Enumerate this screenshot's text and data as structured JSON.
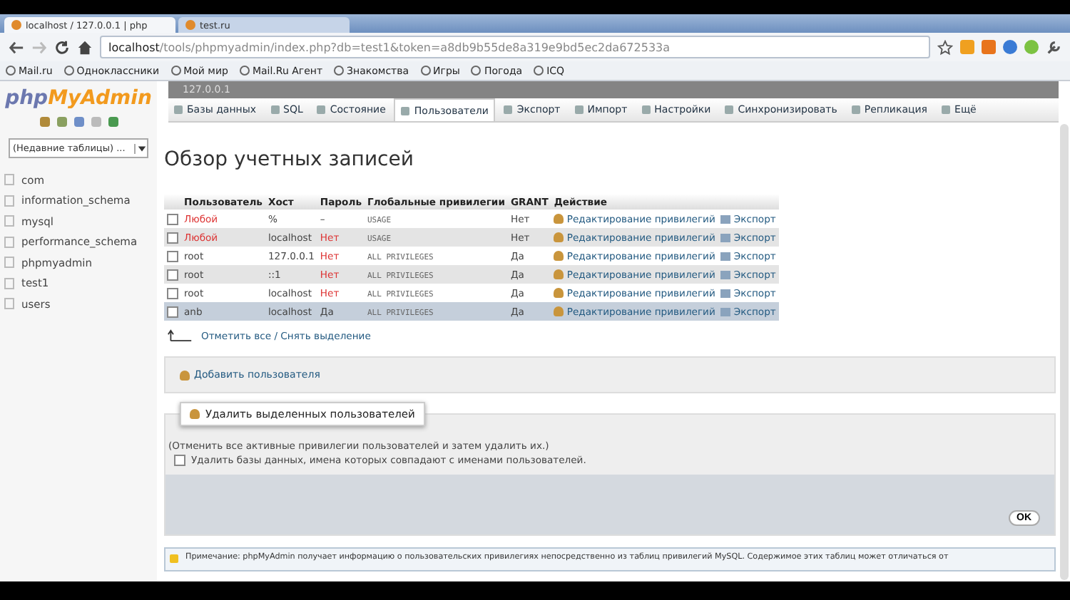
{
  "browser": {
    "tabs": [
      {
        "label": "localhost / 127.0.0.1 | php",
        "selected": true
      },
      {
        "label": "test.ru",
        "selected": false
      }
    ],
    "url_host": "localhost",
    "url_path": "/tools/phpmyadmin/index.php?db=test1&token=a8db9b55de8a319e9bd5ec2da672533a",
    "bookmarks": [
      "Mail.ru",
      "Одноклассники",
      "Мой мир",
      "Mail.Ru Агент",
      "Знакомства",
      "Игры",
      "Погода",
      "ICQ"
    ]
  },
  "sidebar": {
    "logo_a": "php",
    "logo_b": "MyAdmin",
    "recent": "(Недавние таблицы) ...",
    "databases": [
      "com",
      "information_schema",
      "mysql",
      "performance_schema",
      "phpmyadmin",
      "test1",
      "users"
    ]
  },
  "server": "127.0.0.1",
  "tabs": [
    {
      "label": "Базы данных",
      "selected": false
    },
    {
      "label": "SQL",
      "selected": false
    },
    {
      "label": "Состояние",
      "selected": false
    },
    {
      "label": "Пользователи",
      "selected": true
    },
    {
      "label": "Экспорт",
      "selected": false
    },
    {
      "label": "Импорт",
      "selected": false
    },
    {
      "label": "Настройки",
      "selected": false
    },
    {
      "label": "Синхронизировать",
      "selected": false
    },
    {
      "label": "Репликация",
      "selected": false
    },
    {
      "label": "Ещё",
      "selected": false
    }
  ],
  "heading": "Обзор учетных записей",
  "table": {
    "columns": [
      "Пользователь",
      "Хост",
      "Пароль",
      "Глобальные привилегии",
      "GRANT",
      "Действие"
    ],
    "rows": [
      {
        "user": "Любой",
        "user_any": true,
        "host": "%",
        "password": "–",
        "password_missing": false,
        "privileges": "USAGE",
        "grant": "Нет",
        "edit": "Редактирование привилегий",
        "export": "Экспорт",
        "checked": false,
        "highlighted": false
      },
      {
        "user": "Любой",
        "user_any": true,
        "host": "localhost",
        "password": "Нет",
        "password_missing": true,
        "privileges": "USAGE",
        "grant": "Нет",
        "edit": "Редактирование привилегий",
        "export": "Экспорт",
        "checked": false,
        "highlighted": false
      },
      {
        "user": "root",
        "user_any": false,
        "host": "127.0.0.1",
        "password": "Нет",
        "password_missing": true,
        "privileges": "ALL PRIVILEGES",
        "grant": "Да",
        "edit": "Редактирование привилегий",
        "export": "Экспорт",
        "checked": false,
        "highlighted": false
      },
      {
        "user": "root",
        "user_any": false,
        "host": "::1",
        "password": "Нет",
        "password_missing": true,
        "privileges": "ALL PRIVILEGES",
        "grant": "Да",
        "edit": "Редактирование привилегий",
        "export": "Экспорт",
        "checked": false,
        "highlighted": false
      },
      {
        "user": "root",
        "user_any": false,
        "host": "localhost",
        "password": "Нет",
        "password_missing": true,
        "privileges": "ALL PRIVILEGES",
        "grant": "Да",
        "edit": "Редактирование привилегий",
        "export": "Экспорт",
        "checked": false,
        "highlighted": false
      },
      {
        "user": "anb",
        "user_any": false,
        "host": "localhost",
        "password": "Да",
        "password_missing": false,
        "privileges": "ALL PRIVILEGES",
        "grant": "Да",
        "edit": "Редактирование привилегий",
        "export": "Экспорт",
        "checked": false,
        "highlighted": true
      }
    ]
  },
  "check_all": "Отметить все / Снять выделение",
  "add_user": "Добавить пользователя",
  "delete": {
    "legend": "Удалить выделенных пользователей",
    "hint": "(Отменить все активные привилегии пользователей и затем удалить их.)",
    "drop_db": {
      "label": "Удалить базы данных, имена которых совпадают с именами пользователей.",
      "checked": false
    },
    "ok": "OK"
  },
  "note": "Примечание: phpMyAdmin получает информацию о пользовательских привилегиях непосредственно из таблиц привилегий MySQL. Содержимое этих таблиц может отличаться от"
}
